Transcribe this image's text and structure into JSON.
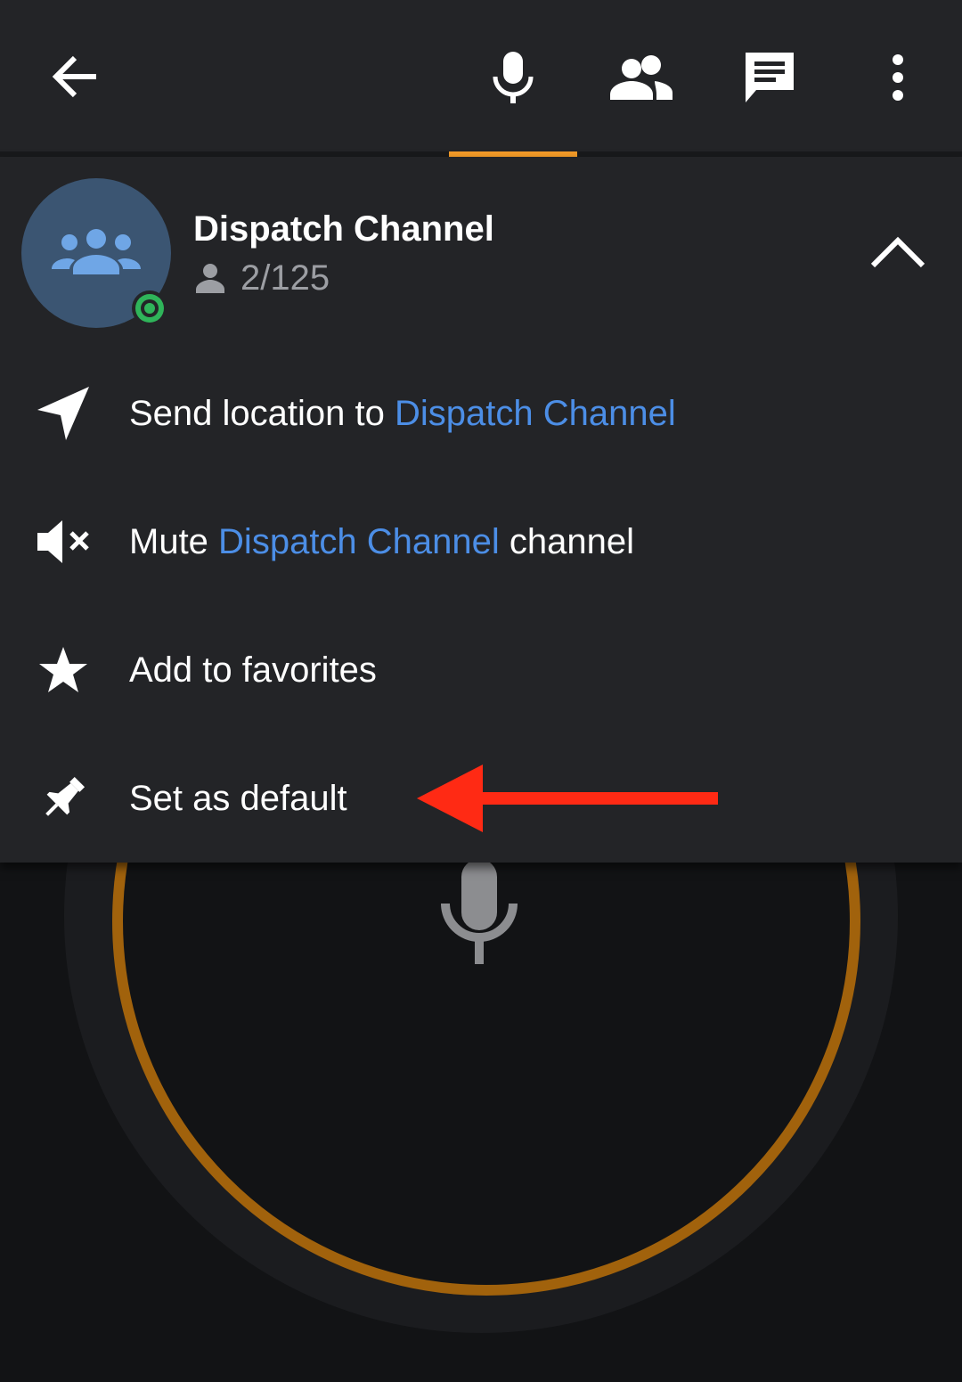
{
  "toolbar": {
    "back_icon": "arrow-back-icon",
    "tabs": [
      {
        "icon": "microphone-icon",
        "selected": true
      },
      {
        "icon": "people-icon",
        "selected": false
      },
      {
        "icon": "chat-icon",
        "selected": false
      }
    ],
    "more_icon": "more-vertical-icon",
    "accent_color": "#f29a28"
  },
  "channel": {
    "name": "Dispatch Channel",
    "members_count": "2/125",
    "status_color": "#2fb45a",
    "avatar_color": "#3b5572"
  },
  "menu": {
    "send_location": {
      "prefix": "Send location to ",
      "channel": "Dispatch Channel"
    },
    "mute": {
      "prefix": "Mute ",
      "channel": "Dispatch Channel",
      "suffix": " channel"
    },
    "favorites": {
      "label": "Add to favorites"
    },
    "default": {
      "label": "Set as default"
    },
    "link_color": "#4c8ee6"
  },
  "annotation": {
    "arrow_color": "#ff2a14"
  },
  "ptt": {
    "ring_color": "#a1620c"
  }
}
